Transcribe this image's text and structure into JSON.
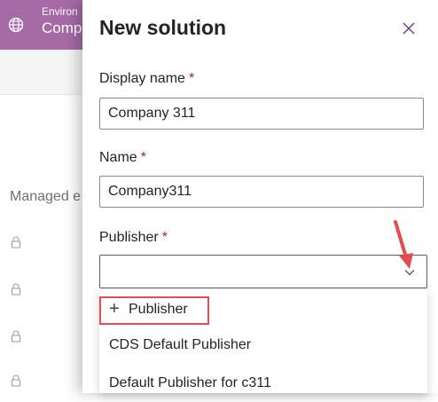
{
  "background": {
    "environment_label": "Environ",
    "environment_name": "Comp",
    "column_header": "Managed e"
  },
  "panel": {
    "title": "New solution",
    "display_name": {
      "label": "Display name",
      "required_mark": "*",
      "value": "Company 311"
    },
    "name": {
      "label": "Name",
      "required_mark": "*",
      "value": "Company311"
    },
    "publisher": {
      "label": "Publisher",
      "required_mark": "*",
      "value": "",
      "options": [
        {
          "icon": "plus-icon",
          "label": "Publisher"
        },
        {
          "label": "CDS Default Publisher"
        },
        {
          "label": "Default Publisher for c311"
        }
      ]
    }
  },
  "colors": {
    "header_bg": "#a66aa6",
    "close_icon": "#7a3b8c",
    "annotation_red": "#e24d4d",
    "required_mark": "#a4262c"
  },
  "icons": [
    "globe-icon",
    "lock-icon",
    "close-icon",
    "chevron-down-icon",
    "plus-icon",
    "annotation-arrow"
  ]
}
